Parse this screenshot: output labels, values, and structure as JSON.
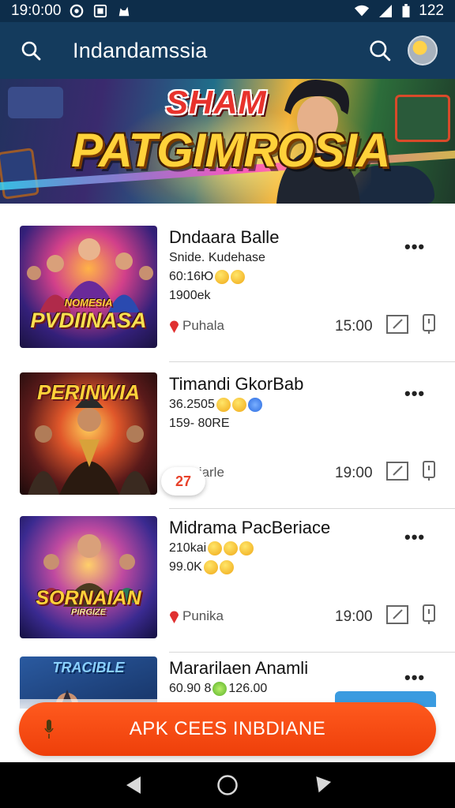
{
  "status_bar": {
    "time": "19:0:00",
    "battery": "122",
    "icons": [
      "notification-icon",
      "photo-icon",
      "cat-icon",
      "wifi-icon",
      "signal-icon",
      "battery-icon"
    ]
  },
  "app_bar": {
    "title": "Indandamssia",
    "left_icon": "search-icon",
    "right_icon": "search-icon",
    "avatar": "avatar"
  },
  "banner": {
    "subtitle": "SHAM",
    "title": "PATGIMROSIA"
  },
  "cards": [
    {
      "thumb_label": "NOMESIA PVDIINASA",
      "thumb_title_top": "NOMESIA",
      "thumb_title_bottom": "PVDIINASA",
      "name": "Dndaara Balle",
      "line2": "Snide. Kudehase",
      "line3": "60:16Ю",
      "line4": "1900ek",
      "location": "Puhala",
      "time": "15:00"
    },
    {
      "thumb_title_top": "PERINWIA",
      "name": "Timandi GkorBab",
      "line2": "36.2505",
      "line3": "159- 80RE",
      "location": "Pniarle",
      "time": "19:00"
    },
    {
      "thumb_title_top": "SORNAIAN",
      "thumb_title_bottom": "PIRGIZE",
      "name": "Midrama PacBeriace",
      "line2": "210kai",
      "line3": "99.0K",
      "location": "Punika",
      "time": "19:00"
    },
    {
      "thumb_title_top": "TRACIBLE",
      "name": "Mararilaen Anamli",
      "line2": "60.90 8",
      "line2b": "126.00"
    }
  ],
  "floating_chip": "27",
  "cta": {
    "label": "APK CEES INBDIANE"
  },
  "nav_bar": {
    "icons": [
      "back-icon",
      "home-icon",
      "recents-icon"
    ]
  },
  "colors": {
    "status_bar": "#0d2d4a",
    "app_bar": "#143b5d",
    "cta": "#ee3f0a",
    "pin": "#e03030"
  }
}
